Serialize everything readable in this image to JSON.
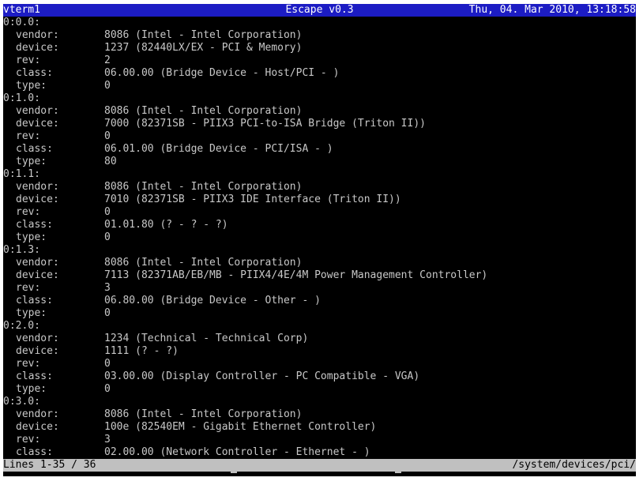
{
  "titlebar": {
    "left": "vterm1",
    "center": "Escape v0.3",
    "right": "Thu, 04. Mar 2010, 13:18:58"
  },
  "colors": {
    "titlebar_bg": "#1c1cc4",
    "terminal_bg": "#000000",
    "terminal_fg": "#c8c8c8",
    "statusbar_bg": "#c0c0c0"
  },
  "lines": [
    {
      "address": "0:0.0:"
    },
    {
      "key": "vendor:",
      "value": "8086 (Intel - Intel Corporation)"
    },
    {
      "key": "device:",
      "value": "1237 (82440LX/EX - PCI & Memory)"
    },
    {
      "key": "rev:",
      "value": "2"
    },
    {
      "key": "class:",
      "value": "06.00.00 (Bridge Device - Host/PCI - )"
    },
    {
      "key": "type:",
      "value": "0"
    },
    {
      "address": "0:1.0:"
    },
    {
      "key": "vendor:",
      "value": "8086 (Intel - Intel Corporation)"
    },
    {
      "key": "device:",
      "value": "7000 (82371SB - PIIX3 PCI-to-ISA Bridge (Triton II))"
    },
    {
      "key": "rev:",
      "value": "0"
    },
    {
      "key": "class:",
      "value": "06.01.00 (Bridge Device - PCI/ISA - )"
    },
    {
      "key": "type:",
      "value": "80"
    },
    {
      "address": "0:1.1:"
    },
    {
      "key": "vendor:",
      "value": "8086 (Intel - Intel Corporation)"
    },
    {
      "key": "device:",
      "value": "7010 (82371SB - PIIX3 IDE Interface (Triton II))"
    },
    {
      "key": "rev:",
      "value": "0"
    },
    {
      "key": "class:",
      "value": "01.01.80 (? - ? - ?)"
    },
    {
      "key": "type:",
      "value": "0"
    },
    {
      "address": "0:1.3:"
    },
    {
      "key": "vendor:",
      "value": "8086 (Intel - Intel Corporation)"
    },
    {
      "key": "device:",
      "value": "7113 (82371AB/EB/MB - PIIX4/4E/4M Power Management Controller)"
    },
    {
      "key": "rev:",
      "value": "3"
    },
    {
      "key": "class:",
      "value": "06.80.00 (Bridge Device - Other - )"
    },
    {
      "key": "type:",
      "value": "0"
    },
    {
      "address": "0:2.0:"
    },
    {
      "key": "vendor:",
      "value": "1234 (Technical - Technical Corp)"
    },
    {
      "key": "device:",
      "value": "1111 (? - ?)"
    },
    {
      "key": "rev:",
      "value": "0"
    },
    {
      "key": "class:",
      "value": "03.00.00 (Display Controller - PC Compatible - VGA)"
    },
    {
      "key": "type:",
      "value": "0"
    },
    {
      "address": "0:3.0:"
    },
    {
      "key": "vendor:",
      "value": "8086 (Intel - Intel Corporation)"
    },
    {
      "key": "device:",
      "value": "100e (82540EM - Gigabit Ethernet Controller)"
    },
    {
      "key": "rev:",
      "value": "3"
    },
    {
      "key": "class:",
      "value": "02.00.00 (Network Controller - Ethernet - )"
    }
  ],
  "statusbar": {
    "left": "Lines 1-35 / 36",
    "right": "/system/devices/pci/"
  }
}
